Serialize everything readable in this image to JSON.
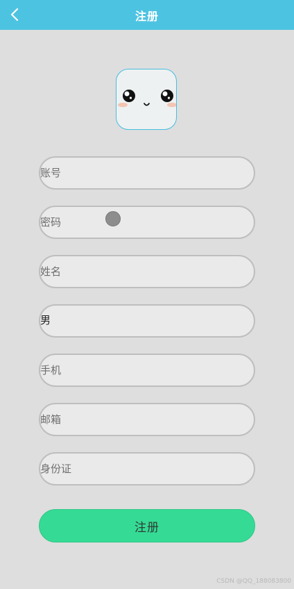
{
  "header": {
    "title": "注册",
    "back_icon": "chevron-left-icon",
    "bg_color": "#4dc3e2"
  },
  "avatar": {
    "icon": "cute-face-icon"
  },
  "form": {
    "account_placeholder": "账号",
    "password_placeholder": "密码",
    "name_placeholder": "姓名",
    "gender_value": "男",
    "phone_placeholder": "手机",
    "email_placeholder": "邮箱",
    "idcard_placeholder": "身份证",
    "submit_label": "注册",
    "submit_color": "#35db95"
  },
  "watermark": "CSDN @QQ_188083800"
}
